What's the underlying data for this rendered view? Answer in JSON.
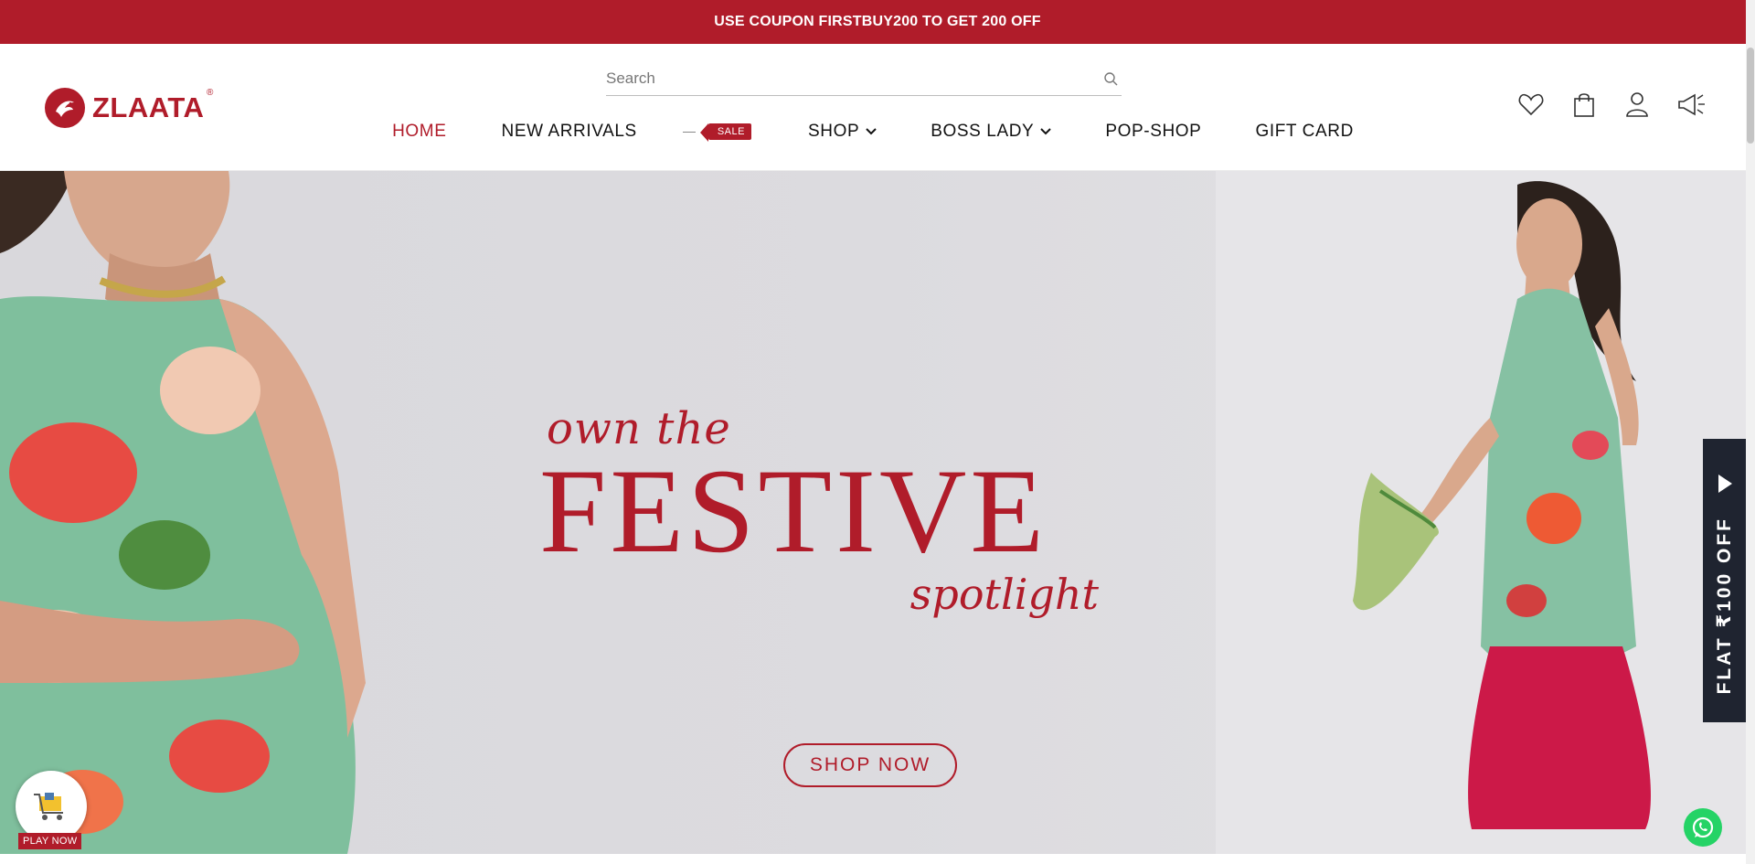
{
  "announcement": {
    "text": "USE COUPON FIRSTBUY200 TO GET 200 OFF"
  },
  "brand": {
    "name": "ZLAATA",
    "registered": "®",
    "color": "#b01c2a"
  },
  "search": {
    "placeholder": "Search"
  },
  "nav": {
    "items": [
      {
        "label": "HOME",
        "active": true
      },
      {
        "label": "NEW ARRIVALS"
      },
      {
        "label": "SALE",
        "tag": true
      },
      {
        "label": "SHOP",
        "dropdown": true
      },
      {
        "label": "BOSS LADY",
        "dropdown": true
      },
      {
        "label": "POP-SHOP"
      },
      {
        "label": "GIFT CARD"
      }
    ]
  },
  "header_icons": [
    "heart-icon",
    "bag-icon",
    "user-icon",
    "megaphone-icon"
  ],
  "hero": {
    "line1": "own the",
    "line2": "FESTIVE",
    "line3": "spotlight",
    "cta": "SHOP NOW"
  },
  "side_tab": {
    "label": "FLAT ₹100 OFF"
  },
  "game": {
    "label": "PLAY NOW"
  },
  "colors": {
    "accent": "#b01c2a",
    "dark_tab": "#1f2430",
    "whatsapp": "#25d366"
  }
}
